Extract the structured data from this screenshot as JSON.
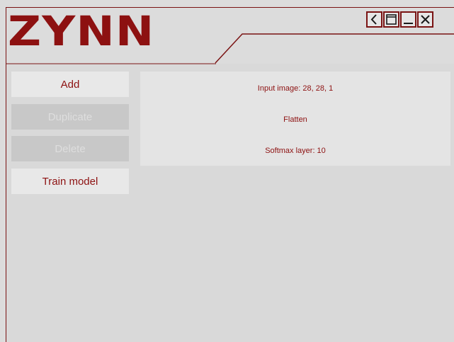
{
  "app": {
    "logo_text": "ZYNN",
    "accent": "#8d1111",
    "frame_color": "#7a1313"
  },
  "window_controls": [
    {
      "name": "back",
      "icon": "chevron-left-icon"
    },
    {
      "name": "maximize",
      "icon": "window-icon"
    },
    {
      "name": "minimize",
      "icon": "minimize-icon"
    },
    {
      "name": "close",
      "icon": "close-icon"
    }
  ],
  "sidebar": {
    "add_label": "Add",
    "duplicate_label": "Duplicate",
    "delete_label": "Delete",
    "train_label": "Train model"
  },
  "layers": [
    {
      "label": "Input image: 28, 28, 1"
    },
    {
      "label": "Flatten"
    },
    {
      "label": "Softmax layer: 10"
    }
  ]
}
